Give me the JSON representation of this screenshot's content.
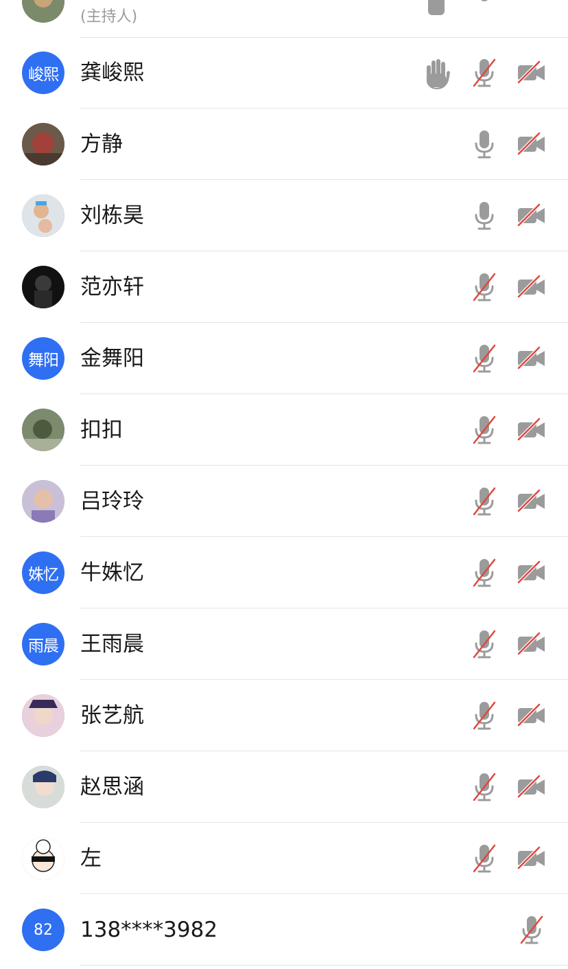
{
  "host_row": {
    "role_label": "(主持人)"
  },
  "participants": [
    {
      "name": "龚峻熙",
      "avatar_kind": "text",
      "avatar_text": "峻熙",
      "hand_raised": true,
      "mic": "muted",
      "camera": "off"
    },
    {
      "name": "方静",
      "avatar_kind": "photo",
      "avatar_text": "",
      "hand_raised": false,
      "mic": "on",
      "camera": "off"
    },
    {
      "name": "刘栋昊",
      "avatar_kind": "photo",
      "avatar_text": "",
      "hand_raised": false,
      "mic": "on",
      "camera": "off"
    },
    {
      "name": "范亦轩",
      "avatar_kind": "photo",
      "avatar_text": "",
      "hand_raised": false,
      "mic": "muted",
      "camera": "off"
    },
    {
      "name": "金舞阳",
      "avatar_kind": "text",
      "avatar_text": "舞阳",
      "hand_raised": false,
      "mic": "muted",
      "camera": "off"
    },
    {
      "name": "扣扣",
      "avatar_kind": "photo",
      "avatar_text": "",
      "hand_raised": false,
      "mic": "muted",
      "camera": "off"
    },
    {
      "name": "吕玲玲",
      "avatar_kind": "photo",
      "avatar_text": "",
      "hand_raised": false,
      "mic": "muted",
      "camera": "off"
    },
    {
      "name": "牛姝忆",
      "avatar_kind": "text",
      "avatar_text": "姝忆",
      "hand_raised": false,
      "mic": "muted",
      "camera": "off"
    },
    {
      "name": "王雨晨",
      "avatar_kind": "text",
      "avatar_text": "雨晨",
      "hand_raised": false,
      "mic": "muted",
      "camera": "off"
    },
    {
      "name": "张艺航",
      "avatar_kind": "photo",
      "avatar_text": "",
      "hand_raised": false,
      "mic": "muted",
      "camera": "off"
    },
    {
      "name": "赵思涵",
      "avatar_kind": "photo",
      "avatar_text": "",
      "hand_raised": false,
      "mic": "muted",
      "camera": "off"
    },
    {
      "name": "左",
      "avatar_kind": "photo",
      "avatar_text": "",
      "hand_raised": false,
      "mic": "muted",
      "camera": "off"
    },
    {
      "name": "138****3982",
      "avatar_kind": "num",
      "avatar_text": "82",
      "hand_raised": false,
      "mic": "muted",
      "camera": "none"
    }
  ],
  "colors": {
    "accent": "#2f6ff2",
    "icon_gray": "#9b9b9b",
    "muted_slash": "#e0463f",
    "divider": "#e4e4e6"
  },
  "icons": {
    "hand": "raised-hand-icon",
    "mic_on": "microphone-icon",
    "mic_muted": "microphone-muted-icon",
    "camera_off": "camera-off-icon"
  }
}
